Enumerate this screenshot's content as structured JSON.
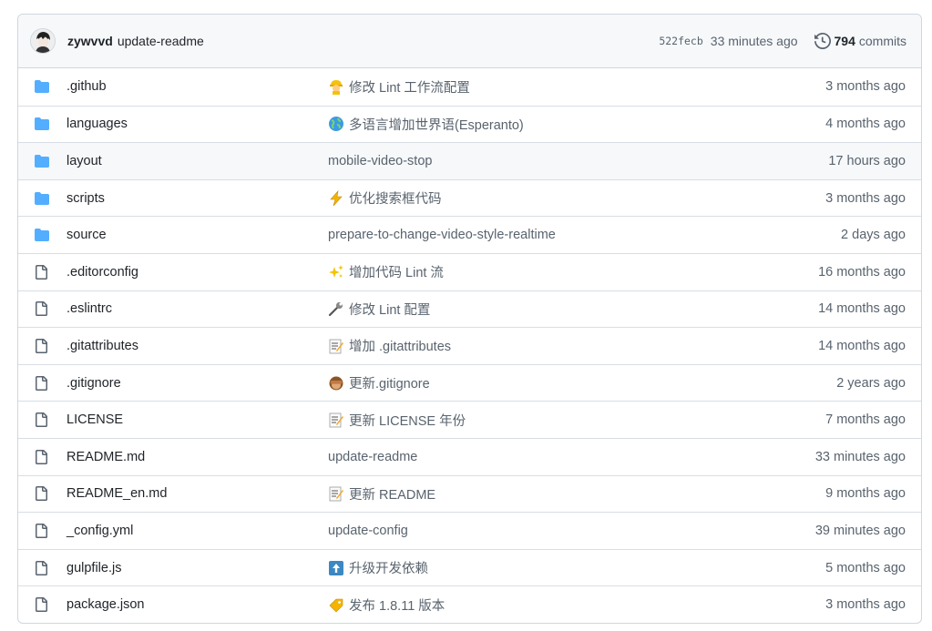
{
  "last_commit": {
    "author": "zywvvd",
    "message": "update-readme",
    "sha": "522fecb",
    "time": "33 minutes ago",
    "commit_count": "794",
    "commits_label": "commits"
  },
  "files": [
    {
      "name": ".github",
      "type": "folder",
      "message": "修改 Lint 工作流配置",
      "emoji": "construction-worker-icon",
      "age": "3 months ago"
    },
    {
      "name": "languages",
      "type": "folder",
      "message": "多语言增加世界语(Esperanto)",
      "emoji": "globe-icon",
      "age": "4 months ago"
    },
    {
      "name": "layout",
      "type": "folder",
      "message": "mobile-video-stop",
      "emoji": "",
      "age": "17 hours ago"
    },
    {
      "name": "scripts",
      "type": "folder",
      "message": "优化搜索框代码",
      "emoji": "zap-icon",
      "age": "3 months ago"
    },
    {
      "name": "source",
      "type": "folder",
      "message": "prepare-to-change-video-style-realtime",
      "emoji": "",
      "age": "2 days ago"
    },
    {
      "name": ".editorconfig",
      "type": "file",
      "message": "增加代码 Lint 流",
      "emoji": "sparkles-icon",
      "age": "16 months ago"
    },
    {
      "name": ".eslintrc",
      "type": "file",
      "message": "修改 Lint 配置",
      "emoji": "wrench-icon",
      "age": "14 months ago"
    },
    {
      "name": ".gitattributes",
      "type": "file",
      "message": "增加 .gitattributes",
      "emoji": "memo-icon",
      "age": "14 months ago"
    },
    {
      "name": ".gitignore",
      "type": "file",
      "message": "更新.gitignore",
      "emoji": "see-no-evil-icon",
      "age": "2 years ago"
    },
    {
      "name": "LICENSE",
      "type": "file",
      "message": "更新 LICENSE 年份",
      "emoji": "memo-icon",
      "age": "7 months ago"
    },
    {
      "name": "README.md",
      "type": "file",
      "message": "update-readme",
      "emoji": "",
      "age": "33 minutes ago"
    },
    {
      "name": "README_en.md",
      "type": "file",
      "message": "更新 README",
      "emoji": "memo-icon",
      "age": "9 months ago"
    },
    {
      "name": "_config.yml",
      "type": "file",
      "message": "update-config",
      "emoji": "",
      "age": "39 minutes ago"
    },
    {
      "name": "gulpfile.js",
      "type": "file",
      "message": "升级开发依赖",
      "emoji": "arrow-up-icon",
      "age": "5 months ago"
    },
    {
      "name": "package.json",
      "type": "file",
      "message": "发布 1.8.11 版本",
      "emoji": "bookmark-tag-icon",
      "age": "3 months ago"
    }
  ],
  "colors": {
    "folder": "#54aeff",
    "file_icon": "#59636e",
    "muted_text": "#59636e",
    "border": "#d0d7de"
  }
}
